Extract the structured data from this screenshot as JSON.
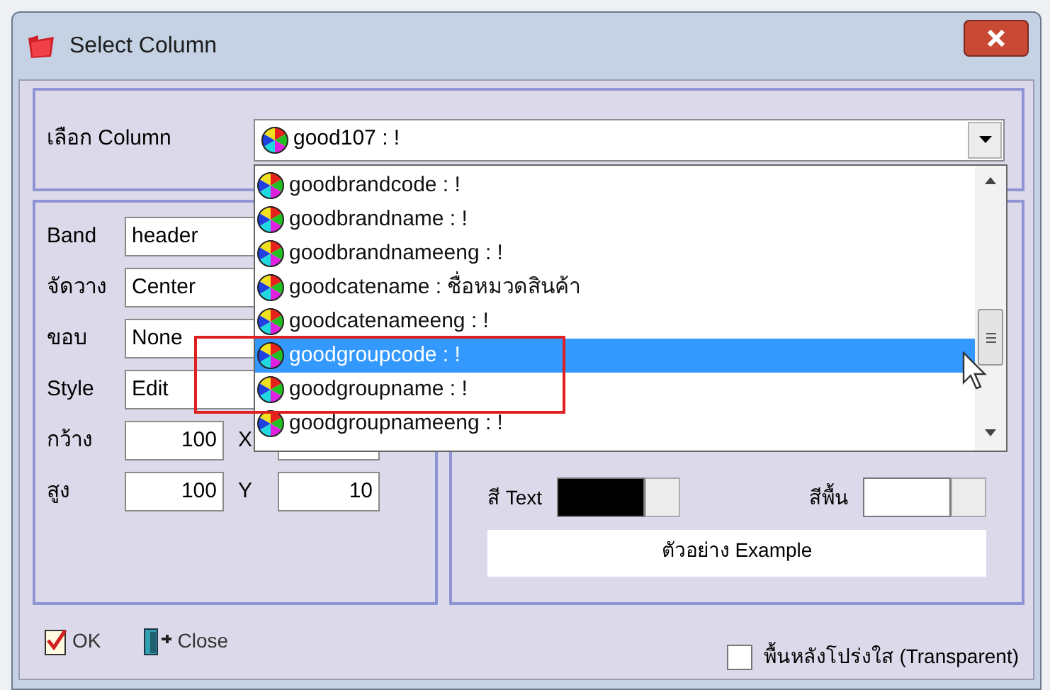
{
  "window": {
    "title": "Select Column"
  },
  "column_select": {
    "label": "เลือก Column",
    "value": "good107 : !",
    "expanded": true,
    "options": [
      {
        "label": "goodbrandcode : !",
        "selected": false
      },
      {
        "label": "goodbrandname : !",
        "selected": false
      },
      {
        "label": "goodbrandnameeng : !",
        "selected": false
      },
      {
        "label": "goodcatename : ชื่อหมวดสินค้า",
        "selected": false
      },
      {
        "label": "goodcatenameeng : !",
        "selected": false
      },
      {
        "label": "goodgroupcode : !",
        "selected": true
      },
      {
        "label": "goodgroupname : !",
        "selected": false
      },
      {
        "label": "goodgroupnameeng : !",
        "selected": false
      }
    ]
  },
  "fields": [
    {
      "label": "Band",
      "value": "header"
    },
    {
      "label": "จัดวาง",
      "value": "Center"
    },
    {
      "label": "ขอบ",
      "value": "None"
    },
    {
      "label": "Style",
      "value": "Edit"
    },
    {
      "label": "กว้าง",
      "value": "100",
      "coord_label": "X"
    },
    {
      "label": "สูง",
      "value": "100",
      "coord_label": "Y",
      "coord_value": "10"
    }
  ],
  "colors": [
    {
      "label": "สี Text",
      "color": "#000000"
    },
    {
      "label": "สีพื้น",
      "color": "#ffffff"
    }
  ],
  "preview": "ตัวอย่าง Example",
  "buttons": [
    {
      "kind": "ok",
      "label": "OK"
    },
    {
      "kind": "close",
      "label": "Close"
    }
  ],
  "transparent": {
    "label": "พื้นหลังโปร่งใส (Transparent)",
    "checked": false
  }
}
